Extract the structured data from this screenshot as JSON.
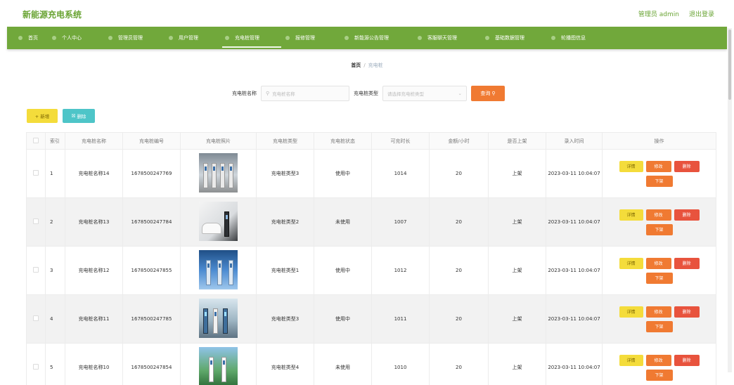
{
  "app": {
    "title": "新能源充电系统"
  },
  "topbar": {
    "admin_label": "管理员 admin",
    "logout_label": "退出登录"
  },
  "nav": {
    "items": [
      {
        "label": "首页"
      },
      {
        "label": "个人中心"
      },
      {
        "label": "管理员管理"
      },
      {
        "label": "用户管理"
      },
      {
        "label": "充电桩管理"
      },
      {
        "label": "报修管理"
      },
      {
        "label": "新能源公告管理"
      },
      {
        "label": "客服聊天管理"
      },
      {
        "label": "基础数据管理"
      },
      {
        "label": "轮播图信息"
      }
    ],
    "active_index": 4
  },
  "breadcrumb": {
    "home": "首页",
    "separator": "/",
    "current": "充电桩"
  },
  "search": {
    "name_label": "充电桩名称",
    "name_placeholder": "充电桩名称",
    "type_label": "充电桩类型",
    "type_placeholder": "请选择充电桩类型",
    "query_label": "查询"
  },
  "actions": {
    "add_label": "+ 新增",
    "delete_label": "删除"
  },
  "table": {
    "headers": [
      "索引",
      "充电桩名称",
      "充电桩编号",
      "充电桩照片",
      "充电桩类型",
      "充电桩状态",
      "可充时长",
      "金额/小时",
      "是否上架",
      "录入时间",
      "操作"
    ],
    "op_labels": {
      "detail": "详情",
      "edit": "修改",
      "delete": "删除",
      "offshelf": "下架"
    },
    "rows": [
      {
        "index": "1",
        "name": "充电桩名称14",
        "code": "1678500247769",
        "type": "充电桩类型3",
        "status": "使用中",
        "duration": "1014",
        "price": "20",
        "onshelf": "上架",
        "time": "2023-03-11 10:04:07"
      },
      {
        "index": "2",
        "name": "充电桩名称13",
        "code": "1678500247784",
        "type": "充电桩类型2",
        "status": "未使用",
        "duration": "1007",
        "price": "20",
        "onshelf": "上架",
        "time": "2023-03-11 10:04:07"
      },
      {
        "index": "3",
        "name": "充电桩名称12",
        "code": "1678500247855",
        "type": "充电桩类型1",
        "status": "使用中",
        "duration": "1012",
        "price": "20",
        "onshelf": "上架",
        "time": "2023-03-11 10:04:07"
      },
      {
        "index": "4",
        "name": "充电桩名称11",
        "code": "1678500247785",
        "type": "充电桩类型3",
        "status": "使用中",
        "duration": "1011",
        "price": "20",
        "onshelf": "上架",
        "time": "2023-03-11 10:04:07"
      },
      {
        "index": "5",
        "name": "充电桩名称10",
        "code": "1678500247854",
        "type": "充电桩类型4",
        "status": "未使用",
        "duration": "1010",
        "price": "20",
        "onshelf": "上架",
        "time": "2023-03-11 10:04:07"
      }
    ]
  },
  "colors": {
    "brand_green": "#71a83b",
    "accent_orange": "#f07a32",
    "accent_yellow": "#f4dc3b",
    "accent_teal": "#4ec5c8",
    "danger_red": "#e8533d"
  }
}
